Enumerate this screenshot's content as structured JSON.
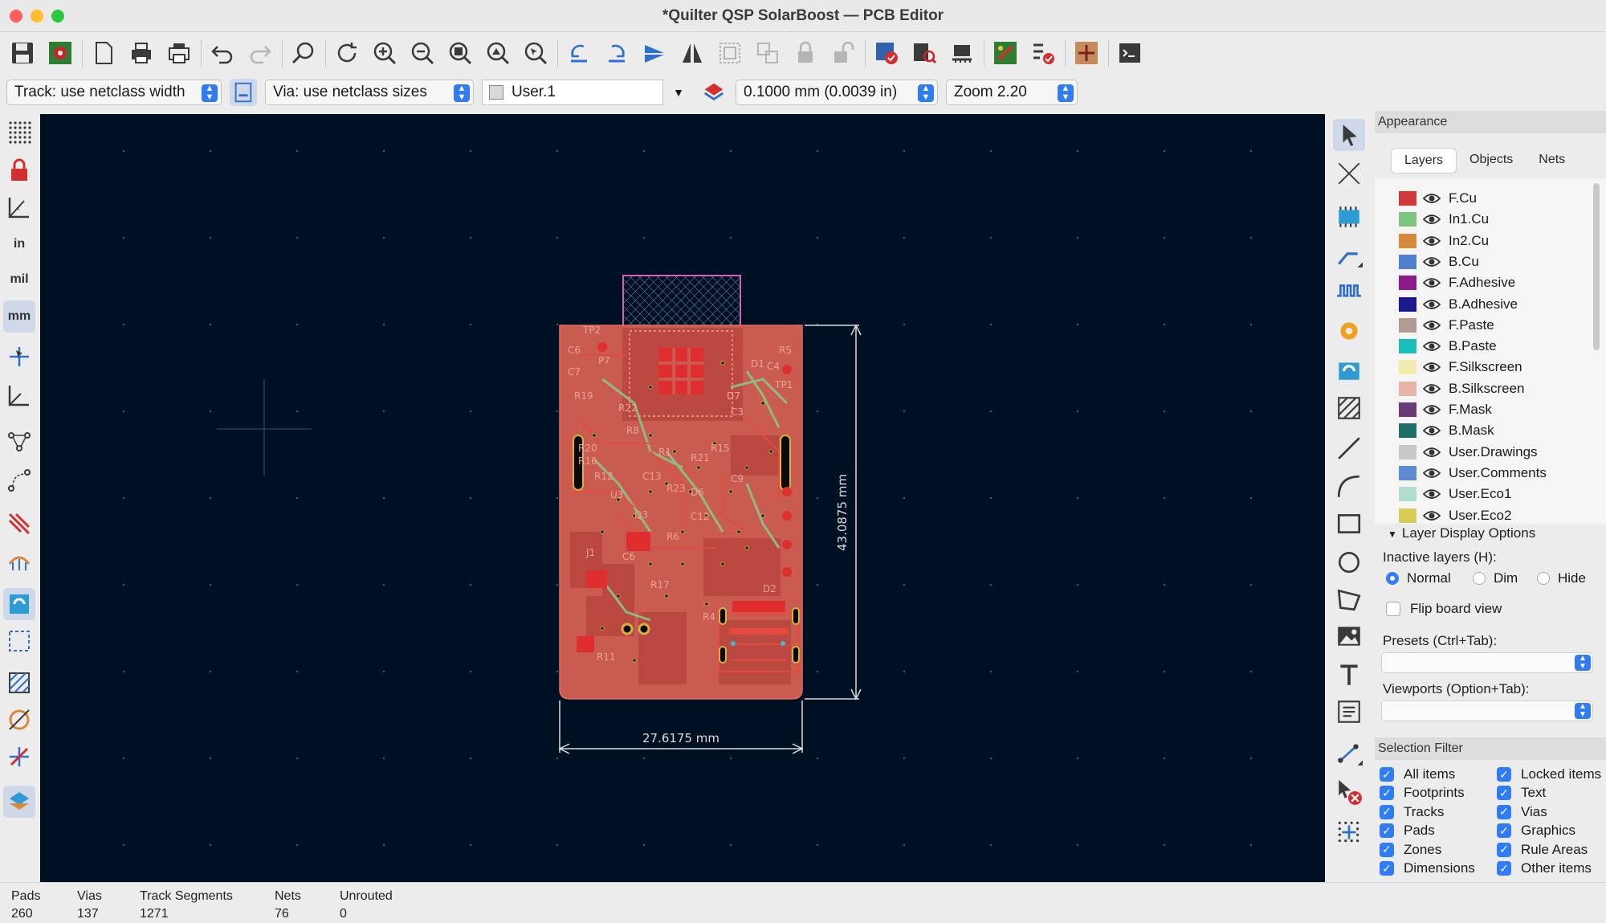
{
  "window": {
    "title": "*Quilter QSP SolarBoost — PCB Editor"
  },
  "optbar": {
    "track": "Track: use netclass width",
    "via": "Via: use netclass sizes",
    "layer": "User.1",
    "grid": "0.1000 mm (0.0039 in)",
    "zoom": "Zoom 2.20"
  },
  "left_toolbar": {
    "units_in": "in",
    "units_mil": "mil",
    "units_mm": "mm"
  },
  "canvas": {
    "dim_width": "27.6175 mm",
    "dim_height": "43.0875 mm",
    "labels": [
      "TP2",
      "C6",
      "P7",
      "R5",
      "C7",
      "C4",
      "TP1",
      "D1",
      "R19",
      "D7",
      "R22",
      "C3",
      "R8",
      "R20",
      "R15",
      "R1",
      "R16",
      "R21",
      "R12",
      "C13",
      "C9",
      "R23",
      "D6",
      "U3",
      "Q3",
      "C12",
      "C6",
      "R6",
      "J1",
      "R17",
      "R4",
      "D2",
      "R11"
    ]
  },
  "appearance": {
    "header": "Appearance",
    "tabs": [
      "Layers",
      "Objects",
      "Nets"
    ],
    "layers": [
      {
        "name": "F.Cu",
        "color": "#d03a3a"
      },
      {
        "name": "In1.Cu",
        "color": "#7fc47f"
      },
      {
        "name": "In2.Cu",
        "color": "#d9893c"
      },
      {
        "name": "B.Cu",
        "color": "#4f7fce"
      },
      {
        "name": "F.Adhesive",
        "color": "#8c1a8c"
      },
      {
        "name": "B.Adhesive",
        "color": "#1a1a8c"
      },
      {
        "name": "F.Paste",
        "color": "#b09a92"
      },
      {
        "name": "B.Paste",
        "color": "#1fbcbc"
      },
      {
        "name": "F.Silkscreen",
        "color": "#f1ebb0"
      },
      {
        "name": "B.Silkscreen",
        "color": "#e8b3a6"
      },
      {
        "name": "F.Mask",
        "color": "#6b3a7b"
      },
      {
        "name": "B.Mask",
        "color": "#1c6e66"
      },
      {
        "name": "User.Drawings",
        "color": "#c8c8c8"
      },
      {
        "name": "User.Comments",
        "color": "#5f8ad4"
      },
      {
        "name": "User.Eco1",
        "color": "#b2dccf"
      },
      {
        "name": "User.Eco2",
        "color": "#d8cc59"
      }
    ],
    "display_options_title": "Layer Display Options",
    "inactive_layers_label": "Inactive layers (H):",
    "inactive_options": [
      "Normal",
      "Dim",
      "Hide"
    ],
    "inactive_selected": "Normal",
    "flip_board": "Flip board view",
    "presets_label": "Presets (Ctrl+Tab):",
    "viewports_label": "Viewports (Option+Tab):"
  },
  "selection_filter": {
    "header": "Selection Filter",
    "items": [
      {
        "label": "All items",
        "checked": true
      },
      {
        "label": "Locked items",
        "checked": true
      },
      {
        "label": "Footprints",
        "checked": true
      },
      {
        "label": "Text",
        "checked": true
      },
      {
        "label": "Tracks",
        "checked": true
      },
      {
        "label": "Vias",
        "checked": true
      },
      {
        "label": "Pads",
        "checked": true
      },
      {
        "label": "Graphics",
        "checked": true
      },
      {
        "label": "Zones",
        "checked": true
      },
      {
        "label": "Rule Areas",
        "checked": true
      },
      {
        "label": "Dimensions",
        "checked": true
      },
      {
        "label": "Other items",
        "checked": true
      }
    ]
  },
  "status": {
    "pads_label": "Pads",
    "pads": "260",
    "vias_label": "Vias",
    "vias": "137",
    "tracks_label": "Track Segments",
    "tracks": "1271",
    "nets_label": "Nets",
    "nets": "76",
    "unrouted_label": "Unrouted",
    "unrouted": "0"
  }
}
